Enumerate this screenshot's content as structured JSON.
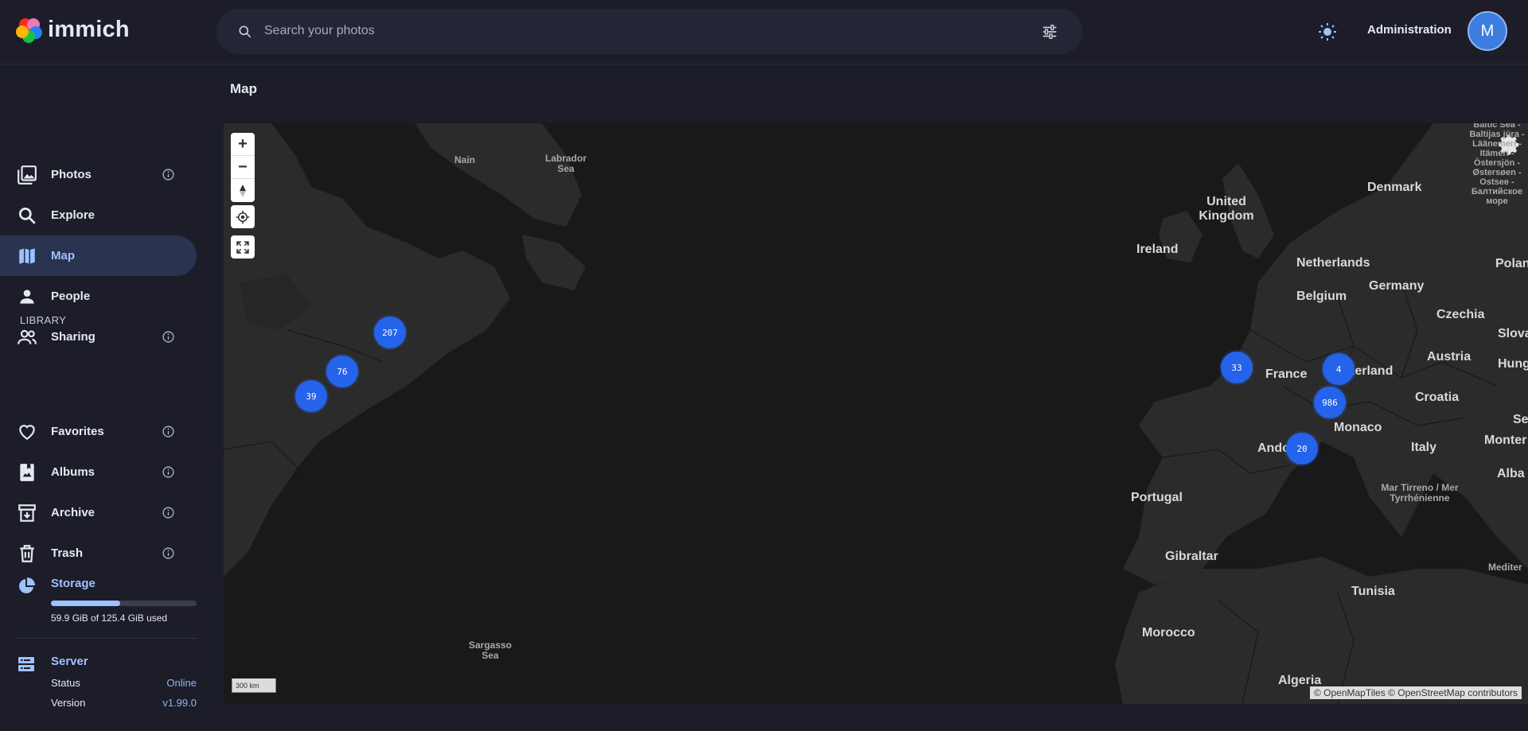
{
  "app": {
    "name": "immich",
    "search_placeholder": "Search your photos",
    "admin_label": "Administration",
    "avatar_initial": "M"
  },
  "sidebar": {
    "items": [
      {
        "label": "Photos",
        "icon": "photos-icon",
        "info": true
      },
      {
        "label": "Explore",
        "icon": "search-icon",
        "info": false
      },
      {
        "label": "Map",
        "icon": "map-icon",
        "info": false,
        "active": true
      },
      {
        "label": "People",
        "icon": "person-icon",
        "info": false
      },
      {
        "label": "Sharing",
        "icon": "people-icon",
        "info": true
      }
    ],
    "library_label": "LIBRARY",
    "library_items": [
      {
        "label": "Favorites",
        "icon": "heart-icon",
        "info": true
      },
      {
        "label": "Albums",
        "icon": "album-icon",
        "info": true
      },
      {
        "label": "Archive",
        "icon": "archive-icon",
        "info": true
      },
      {
        "label": "Trash",
        "icon": "trash-icon",
        "info": true
      }
    ],
    "storage": {
      "title": "Storage",
      "text": "59.9 GiB of 125.4 GiB used",
      "used_fraction": 0.478
    },
    "server": {
      "title": "Server",
      "status_label": "Status",
      "status_value": "Online",
      "version_label": "Version",
      "version_value": "v1.99.0"
    }
  },
  "page": {
    "title": "Map"
  },
  "map": {
    "clusters": [
      {
        "count": "207"
      },
      {
        "count": "76"
      },
      {
        "count": "39"
      },
      {
        "count": "33"
      },
      {
        "count": "4"
      },
      {
        "count": "986"
      },
      {
        "count": "20"
      }
    ],
    "labels": {
      "nain": "Nain",
      "labrador_sea": "Labrador Sea",
      "sargasso_sea": "Sargasso Sea",
      "united_kingdom": "United Kingdom",
      "ireland": "Ireland",
      "denmark": "Denmark",
      "netherlands": "Netherlands",
      "belgium": "Belgium",
      "germany": "Germany",
      "poland": "Polan",
      "czechia": "Czechia",
      "slovakia": "Slova",
      "austria": "Austria",
      "hungary": "Hung",
      "france": "France",
      "switzerland": "tzerland",
      "croatia": "Croatia",
      "serbia": "Se",
      "monaco": "Monaco",
      "andorra": "Ando",
      "italy": "Italy",
      "montenegro": "Monter",
      "albania": "Alba",
      "portugal": "Portugal",
      "tyrrhenian": "Mar Tirreno / Mer Tyrrhénienne",
      "gibraltar": "Gibraltar",
      "tunisia": "Tunisia",
      "mediterranean": "Mediter",
      "morocco": "Morocco",
      "algeria": "Algeria",
      "baltic": "Baltic Sea - Baltijas jūra - Läänemeri - Itämeri - Östersjön - Østersøen - Ostsee - Балтийское море"
    },
    "scale_label": "300 km",
    "attribution": "© OpenMapTiles © OpenStreetMap contributors"
  },
  "colors": {
    "background": "#1c1d29",
    "accent": "#9ec2ff",
    "cluster": "#2563eb",
    "map_water": "#191919",
    "map_land": "#2b2b2b"
  }
}
